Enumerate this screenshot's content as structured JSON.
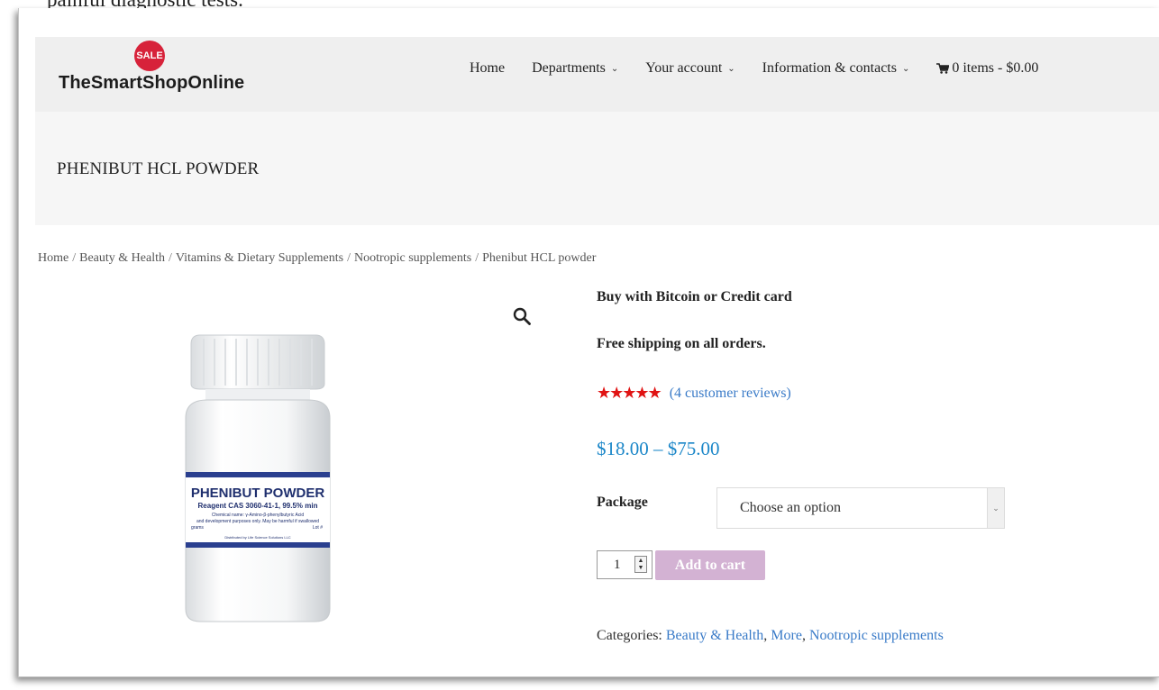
{
  "top_cut_text": "painful diagnostic tests.",
  "logo": {
    "badge": "SALE",
    "name": "TheSmartShopOnline"
  },
  "nav": {
    "items": [
      {
        "label": "Home",
        "has_dropdown": false
      },
      {
        "label": "Departments",
        "has_dropdown": true
      },
      {
        "label": "Your account",
        "has_dropdown": true
      },
      {
        "label": "Information & contacts",
        "has_dropdown": true
      }
    ],
    "cart": {
      "icon": "cart-icon",
      "label": "0 items - $0.00"
    }
  },
  "page_title": "PHENIBUT HCL POWDER",
  "breadcrumb": {
    "items": [
      "Home",
      "Beauty & Health",
      "Vitamins & Dietary Supplements",
      "Nootropic supplements",
      "Phenibut HCL powder"
    ],
    "separator": "/"
  },
  "product_image": {
    "label_title": "PHENIBUT POWDER",
    "label_reagent": "Reagent CAS 3060-41-1, 99.5% min",
    "label_chem": "Chemical name: γ-Amino-β-phenylbutyric Acid",
    "label_dev": "and development purposes only. May be harmful if swallowed",
    "label_qty": "grams",
    "label_lot": "Lot #",
    "label_dist": "Distributed by Life Science Solutions LLC"
  },
  "summary": {
    "buy_line": "Buy with Bitcoin or Credit card",
    "ship_line": "Free shipping on all orders.",
    "rating": {
      "stars": "★★★★★",
      "value": 5,
      "max": 5,
      "reviews": "(4 customer reviews)"
    },
    "price": "$18.00 – $75.00",
    "package": {
      "label": "Package",
      "selected": "Choose an option"
    },
    "quantity": "1",
    "add_to_cart": "Add to cart",
    "categories": {
      "label": "Categories:",
      "items": [
        "Beauty & Health",
        "More",
        "Nootropic supplements"
      ]
    }
  },
  "colors": {
    "header_bg": "#efefef",
    "title_band_bg": "#f6f6f6",
    "sale_badge": "#d7223a",
    "link": "#3a7bc8",
    "price": "#1a86c8",
    "stars": "#e01313",
    "add_to_cart_bg": "#d3b2d3"
  }
}
